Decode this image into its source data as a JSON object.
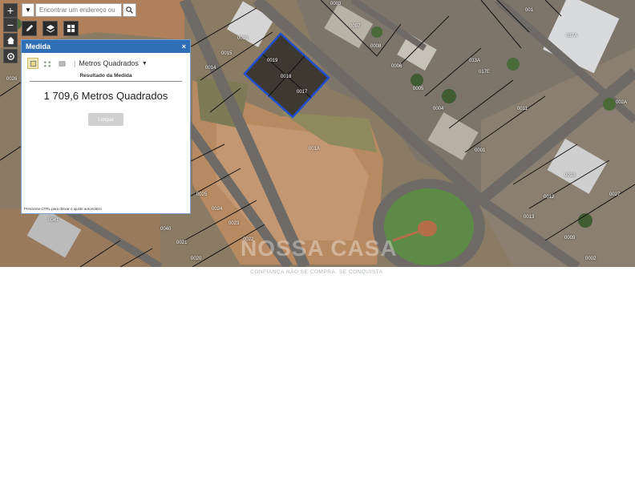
{
  "search": {
    "placeholder": "Encontrar um endereço ou"
  },
  "panel": {
    "title": "Medida",
    "close_label": "×",
    "unit_label": "Metros Quadrados",
    "result_label": "Resultado da Medida",
    "result_value": "1 709,6 Metros Quadrados",
    "clear_label": "Limpar",
    "hint": "Pressione CTRL para deixar o ajuste automático"
  },
  "map": {
    "parcel_labels": [
      "0019",
      "0018",
      "0017",
      "0016",
      "0015",
      "0014",
      "001A",
      "0003",
      "0008",
      "0007",
      "0006",
      "0005",
      "0004",
      "0025",
      "0024",
      "0023",
      "0022",
      "0021",
      "0020",
      "0040",
      "0041",
      "013A",
      "017E",
      "017A",
      "0011",
      "0012",
      "0013",
      "0010",
      "0009",
      "0001",
      "0002",
      "002A",
      "0026",
      "0027",
      "001"
    ],
    "watermark": "NOSSA CASA",
    "slogan": "CONFIANÇA NÃO SE COMPRA. SE CONQUISTA."
  },
  "colors": {
    "panel_header": "#2f6fb5",
    "measure_outline": "#1f4fd1"
  }
}
